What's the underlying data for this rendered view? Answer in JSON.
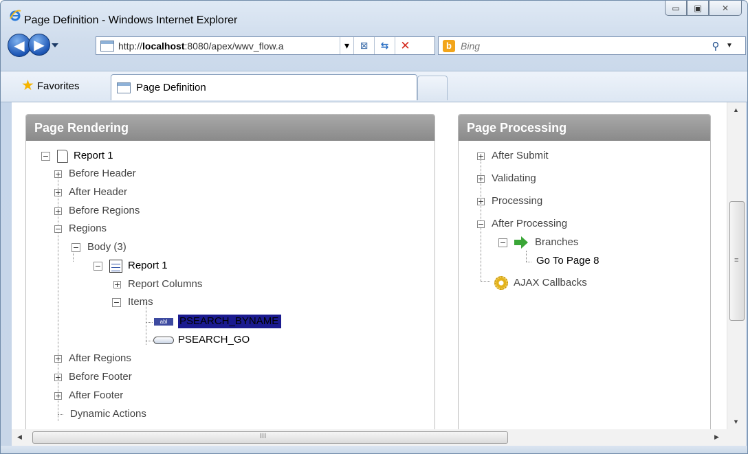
{
  "window": {
    "title": "Page Definition - Windows Internet Explorer",
    "min_glyph": "▭",
    "max_glyph": "▣",
    "close_glyph": "✕"
  },
  "nav": {
    "address_prefix": "http://",
    "address_host": "localhost",
    "address_suffix": ":8080/apex/wwv_flow.a",
    "search_placeholder": "Bing"
  },
  "favorites": {
    "label": "Favorites"
  },
  "tab": {
    "label": "Page Definition"
  },
  "scrollbar": {
    "grip_glyph": "≡",
    "hgrip_glyph": "III"
  },
  "page_rendering": {
    "title": "Page Rendering",
    "root": "Report 1",
    "before_header": "Before Header",
    "after_header": "After Header",
    "before_regions": "Before Regions",
    "regions": "Regions",
    "body": "Body (3)",
    "report": "Report 1",
    "report_columns": "Report Columns",
    "items": "Items",
    "item1": "PSEARCH_BYNAME",
    "item1_icon": "abl",
    "item2": "PSEARCH_GO",
    "after_regions": "After Regions",
    "before_footer": "Before Footer",
    "after_footer": "After Footer",
    "dynamic_actions": "Dynamic Actions"
  },
  "page_processing": {
    "title": "Page Processing",
    "after_submit": "After Submit",
    "validating": "Validating",
    "processing": "Processing",
    "after_processing": "After Processing",
    "branches": "Branches",
    "go_to": "Go To Page 8",
    "ajax": "AJAX Callbacks"
  },
  "colors": {
    "selection": "#1a1a8f",
    "panel_header": "#8a8a8a"
  }
}
